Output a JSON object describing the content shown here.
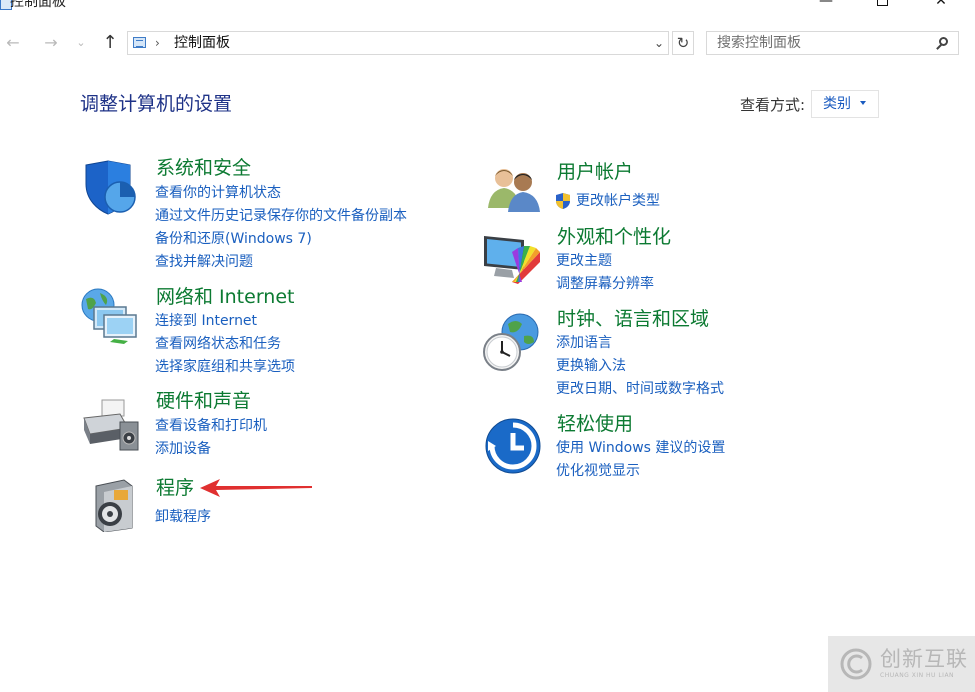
{
  "window": {
    "title": "控制面板",
    "minimize_glyph": "—",
    "close_glyph": "✕"
  },
  "nav": {
    "back_glyph": "←",
    "forward_glyph": "→",
    "recent_glyph": "⌄",
    "up_glyph": "↑",
    "address_separator": "›",
    "address_text": "控制面板",
    "address_dropdown_glyph": "⌄",
    "refresh_glyph": "↻",
    "search_placeholder": "搜索控制面板"
  },
  "header": {
    "title": "调整计算机的设置",
    "view_by_label": "查看方式:",
    "view_by_value": "类别"
  },
  "left_categories": [
    {
      "icon": "shield-icon",
      "title": "系统和安全",
      "links": [
        "查看你的计算机状态",
        "通过文件历史记录保存你的文件备份副本",
        "备份和还原(Windows 7)",
        "查找并解决问题"
      ]
    },
    {
      "icon": "network-icon",
      "title": "网络和 Internet",
      "links": [
        "连接到 Internet",
        "查看网络状态和任务",
        "选择家庭组和共享选项"
      ]
    },
    {
      "icon": "printer-icon",
      "title": "硬件和声音",
      "links": [
        "查看设备和打印机",
        "添加设备"
      ]
    },
    {
      "icon": "programs-icon",
      "title": "程序",
      "links": [
        "卸载程序"
      ]
    }
  ],
  "right_categories": [
    {
      "icon": "users-icon",
      "title": "用户帐户",
      "links": [
        "更改帐户类型"
      ]
    },
    {
      "icon": "monitor-palette-icon",
      "title": "外观和个性化",
      "links": [
        "更改主题",
        "调整屏幕分辨率"
      ]
    },
    {
      "icon": "clock-globe-icon",
      "title": "时钟、语言和区域",
      "links": [
        "添加语言",
        "更换输入法",
        "更改日期、时间或数字格式"
      ]
    },
    {
      "icon": "ease-of-access-icon",
      "title": "轻松使用",
      "links": [
        "使用 Windows 建议的设置",
        "优化视觉显示"
      ]
    }
  ],
  "watermark": {
    "text": "创新互联",
    "subtext": "CHUANG XIN HU LIAN"
  },
  "colors": {
    "category_title": "#0c7a32",
    "link": "#1a5fbf",
    "heading": "#1e3287",
    "annotation_arrow": "#e03030"
  }
}
